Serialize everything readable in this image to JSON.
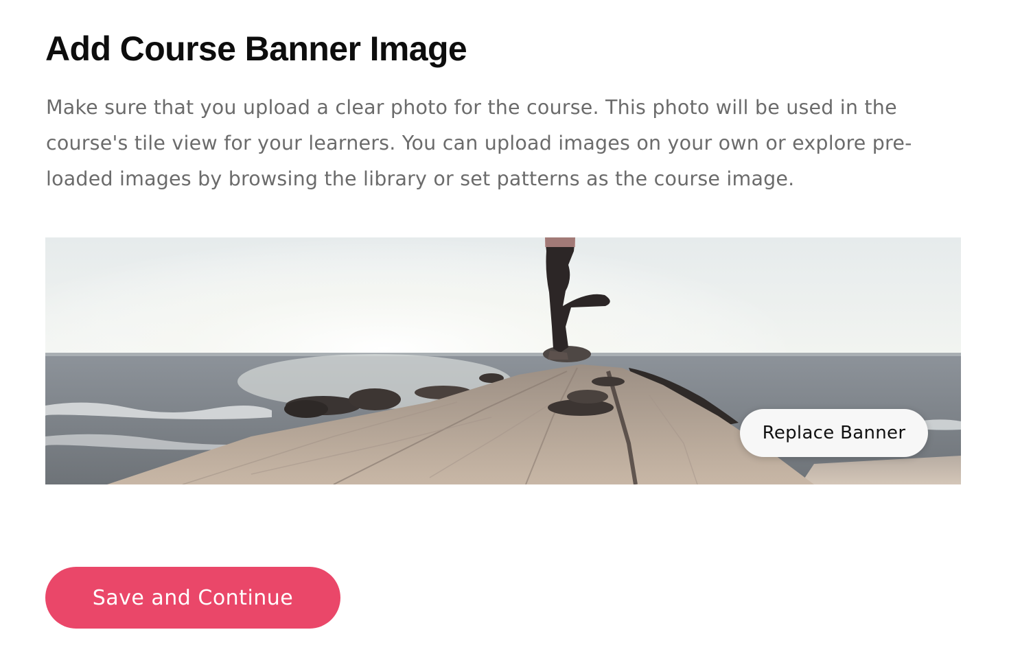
{
  "page": {
    "title": "Add Course Banner Image",
    "description": "Make sure that you upload a clear photo for the course. This photo will be used in the course's tile view for your learners. You can upload images on your own or explore pre-loaded images by browsing the library or set patterns as the course image."
  },
  "banner": {
    "image_subject": "person in yoga tree pose on a wooden pier by the sea",
    "replace_label": "Replace Banner"
  },
  "actions": {
    "save_label": "Save and Continue"
  },
  "colors": {
    "accent": "#ea4769",
    "title_text": "#0d0d0d",
    "body_text": "#6b6b6b",
    "replace_button_bg": "#f7f7f7"
  }
}
